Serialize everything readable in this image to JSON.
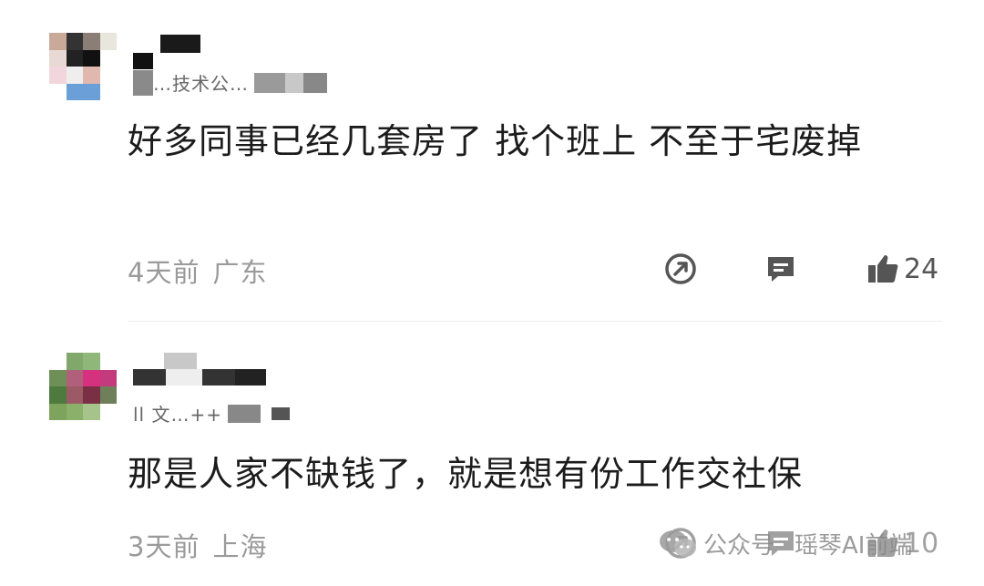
{
  "comments": [
    {
      "subtitle_fragment": "…技术公…",
      "text": "好多同事已经几套房了 找个班上 不至于宅废掉",
      "time": "4天前",
      "location": "广东",
      "likes": "24"
    },
    {
      "subtitle_fragment": "ll 文…++",
      "text": "那是人家不缺钱了，就是想有份工作交社保",
      "time": "3天前",
      "location": "上海",
      "likes": "10"
    }
  ],
  "watermark": {
    "label": "公众号",
    "author": "瑶琴AI前端"
  },
  "icons": {
    "share": "share-icon",
    "reply": "comment-icon",
    "like": "thumbs-up-icon"
  },
  "colors": {
    "text": "#1c1c1c",
    "meta": "#9a9a9a",
    "icon": "#555555",
    "divider": "#ececec"
  }
}
